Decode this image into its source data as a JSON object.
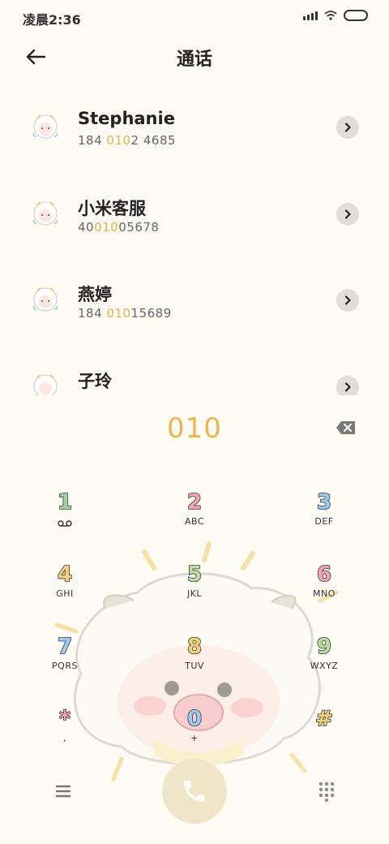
{
  "status_bar": {
    "time": "凌晨2:36"
  },
  "header": {
    "title": "通话"
  },
  "contacts": [
    {
      "name": "Stephanie",
      "number_pre": "184 ",
      "number_hl": "010",
      "number_post": "2 4685"
    },
    {
      "name": "小米客服",
      "number_pre": "40",
      "number_hl": "010",
      "number_post": "05678"
    },
    {
      "name": "燕婷",
      "number_pre": "184 ",
      "number_hl": "010",
      "number_post": "15689"
    },
    {
      "name": "子玲",
      "number_pre": "",
      "number_hl": "",
      "number_post": ""
    }
  ],
  "dialer": {
    "number": "010"
  },
  "keypad": [
    {
      "digit": "1",
      "letters": "",
      "color": "#9fd6a0"
    },
    {
      "digit": "2",
      "letters": "ABC",
      "color": "#f4a4ad"
    },
    {
      "digit": "3",
      "letters": "DEF",
      "color": "#9ccaf0"
    },
    {
      "digit": "4",
      "letters": "GHI",
      "color": "#f6cf7a"
    },
    {
      "digit": "5",
      "letters": "JKL",
      "color": "#b8dea0"
    },
    {
      "digit": "6",
      "letters": "MNO",
      "color": "#f4a4ad"
    },
    {
      "digit": "7",
      "letters": "PQRS",
      "color": "#9ccaf0"
    },
    {
      "digit": "8",
      "letters": "TUV",
      "color": "#f6cf7a"
    },
    {
      "digit": "9",
      "letters": "WXYZ",
      "color": "#b8dea0"
    },
    {
      "digit": "*",
      "letters": ",",
      "color": "#f4a4ad"
    },
    {
      "digit": "0",
      "letters": "+",
      "color": "#9ccaf0"
    },
    {
      "digit": "#",
      "letters": "",
      "color": "#f6cf7a"
    }
  ],
  "colors": {
    "accent": "#f0b350",
    "background": "#fdfbf4",
    "call_button": "#f0e5c6"
  },
  "icons": {
    "back": "arrow-left-icon",
    "backspace": "backspace-icon",
    "menu": "menu-icon",
    "call": "phone-icon",
    "dialpad": "dialpad-icon",
    "voicemail": "voicemail-icon"
  }
}
